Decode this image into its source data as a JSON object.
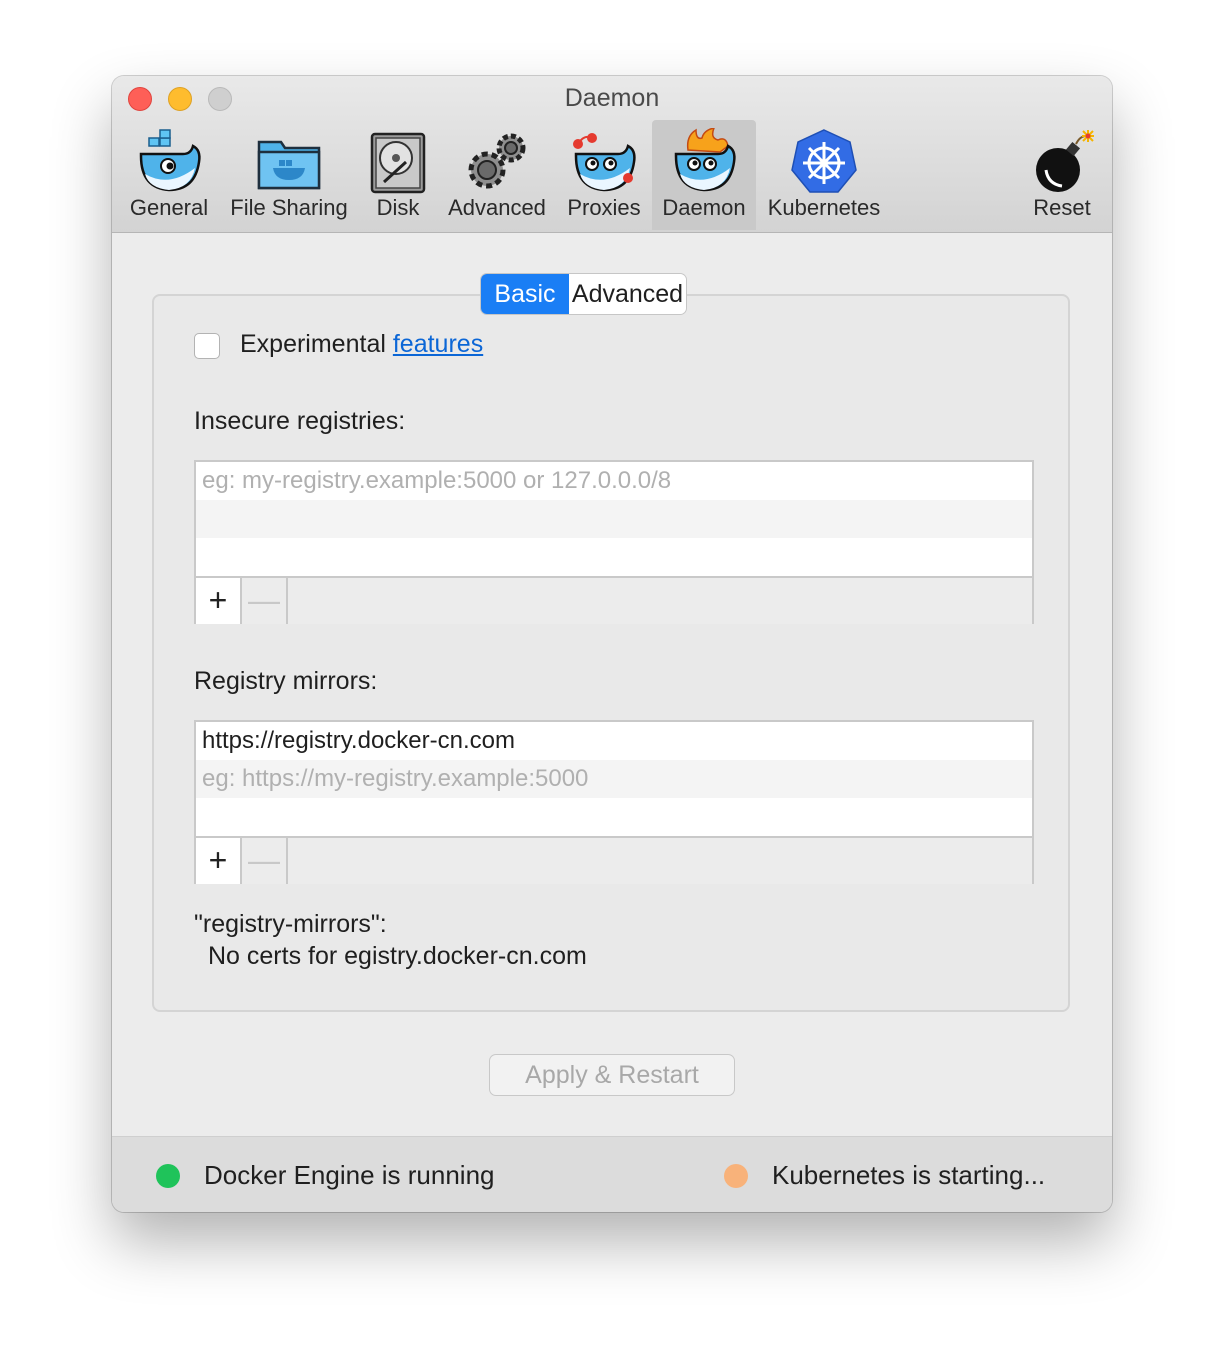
{
  "window": {
    "title": "Daemon"
  },
  "toolbar": {
    "items": [
      {
        "label": "General",
        "icon": "docker-whale-icon"
      },
      {
        "label": "File Sharing",
        "icon": "shared-folder-icon"
      },
      {
        "label": "Disk",
        "icon": "disk-drive-icon"
      },
      {
        "label": "Advanced",
        "icon": "gears-icon"
      },
      {
        "label": "Proxies",
        "icon": "whale-proxies-icon"
      },
      {
        "label": "Daemon",
        "icon": "whale-fire-icon",
        "selected": true
      },
      {
        "label": "Kubernetes",
        "icon": "kubernetes-helm-icon"
      },
      {
        "label": "Reset",
        "icon": "bomb-icon"
      }
    ]
  },
  "tabs": {
    "basic": "Basic",
    "advanced": "Advanced",
    "selected": "Basic"
  },
  "experimental": {
    "label": "Experimental",
    "link": "features",
    "checked": false
  },
  "insecure": {
    "label": "Insecure registries:",
    "placeholder": "eg: my-registry.example:5000 or 127.0.0.0/8",
    "items": []
  },
  "mirrors": {
    "label": "Registry mirrors:",
    "items": [
      "https://registry.docker-cn.com"
    ],
    "placeholder": "eg: https://my-registry.example:5000"
  },
  "list_buttons": {
    "add": "+",
    "remove": "—"
  },
  "note": {
    "line1": "\"registry-mirrors\":",
    "line2": "No certs for egistry.docker-cn.com"
  },
  "apply_button": "Apply & Restart",
  "status": {
    "engine": {
      "text": "Docker Engine is running",
      "color": "#1fc35a"
    },
    "kubernetes": {
      "text": "Kubernetes is starting...",
      "color": "#f8b27a"
    }
  },
  "colors": {
    "accent": "#1a7ef5",
    "link": "#0b66d6"
  }
}
